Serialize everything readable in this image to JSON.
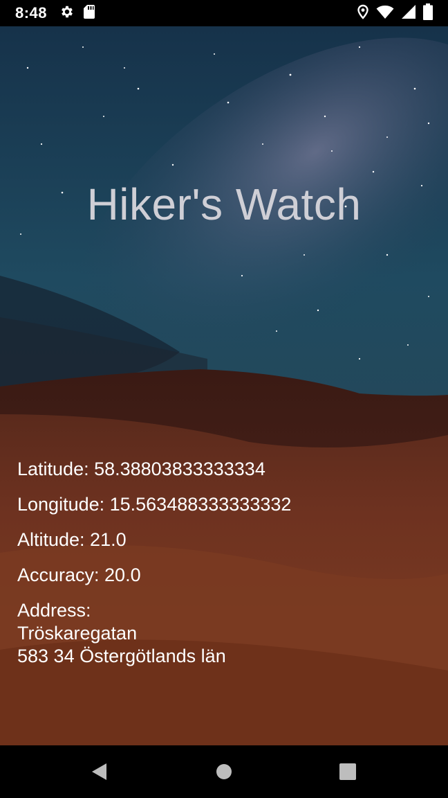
{
  "status_bar": {
    "time": "8:48",
    "icons": [
      "gear-icon",
      "sd-card-icon",
      "location-pin-icon",
      "wifi-icon",
      "cellular-signal-icon",
      "battery-icon"
    ]
  },
  "app": {
    "title": "Hiker's Watch",
    "latitude": "Latitude: 58.38803833333334",
    "longitude": "Longitude: 15.563488333333332",
    "altitude": "Altitude: 21.0",
    "accuracy": "Accuracy: 20.0",
    "address_label": "Address:",
    "address_line1": "Tröskaregatan",
    "address_line2": "583 34 Östergötlands län"
  },
  "nav_bar": {
    "buttons": [
      "back-icon",
      "home-icon",
      "recents-icon"
    ]
  }
}
